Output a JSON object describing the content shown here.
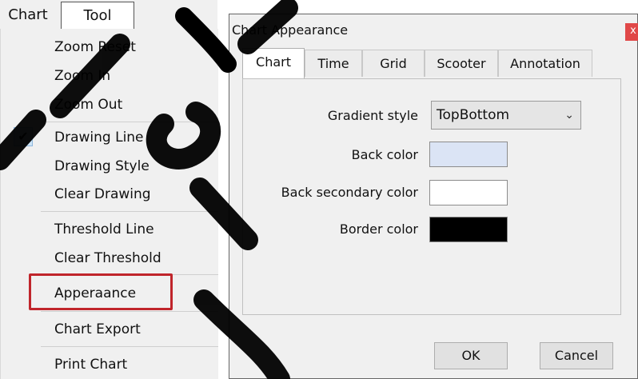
{
  "menu": {
    "tabs": [
      {
        "label": "Chart"
      },
      {
        "label": "Tool"
      }
    ],
    "items": [
      {
        "label": "Zoom Reset"
      },
      {
        "label": "Zoom In"
      },
      {
        "label": "Zoom Out"
      },
      {
        "label": "Drawing Line",
        "checked": true
      },
      {
        "label": "Drawing Style"
      },
      {
        "label": "Clear Drawing"
      },
      {
        "label": "Threshold Line"
      },
      {
        "label": "Clear Threshold"
      },
      {
        "label": "Apperaance",
        "highlighted": true
      },
      {
        "label": "Chart Export"
      },
      {
        "label": "Print Chart"
      }
    ],
    "highlight_color": "#c0252b"
  },
  "dialog": {
    "title": "Chart Appearance",
    "close_label": "x",
    "tabs": [
      {
        "label": "Chart"
      },
      {
        "label": "Time"
      },
      {
        "label": "Grid"
      },
      {
        "label": "Scooter"
      },
      {
        "label": "Annotation"
      }
    ],
    "fields": {
      "gradient_style": {
        "label": "Gradient style",
        "value": "TopBottom"
      },
      "back_color": {
        "label": "Back color",
        "color": "#dbe4f5"
      },
      "back_secondary_color": {
        "label": "Back secondary color",
        "color": "#ffffff"
      },
      "border_color": {
        "label": "Border color",
        "color": "#000000"
      }
    },
    "ok_label": "OK",
    "cancel_label": "Cancel"
  }
}
